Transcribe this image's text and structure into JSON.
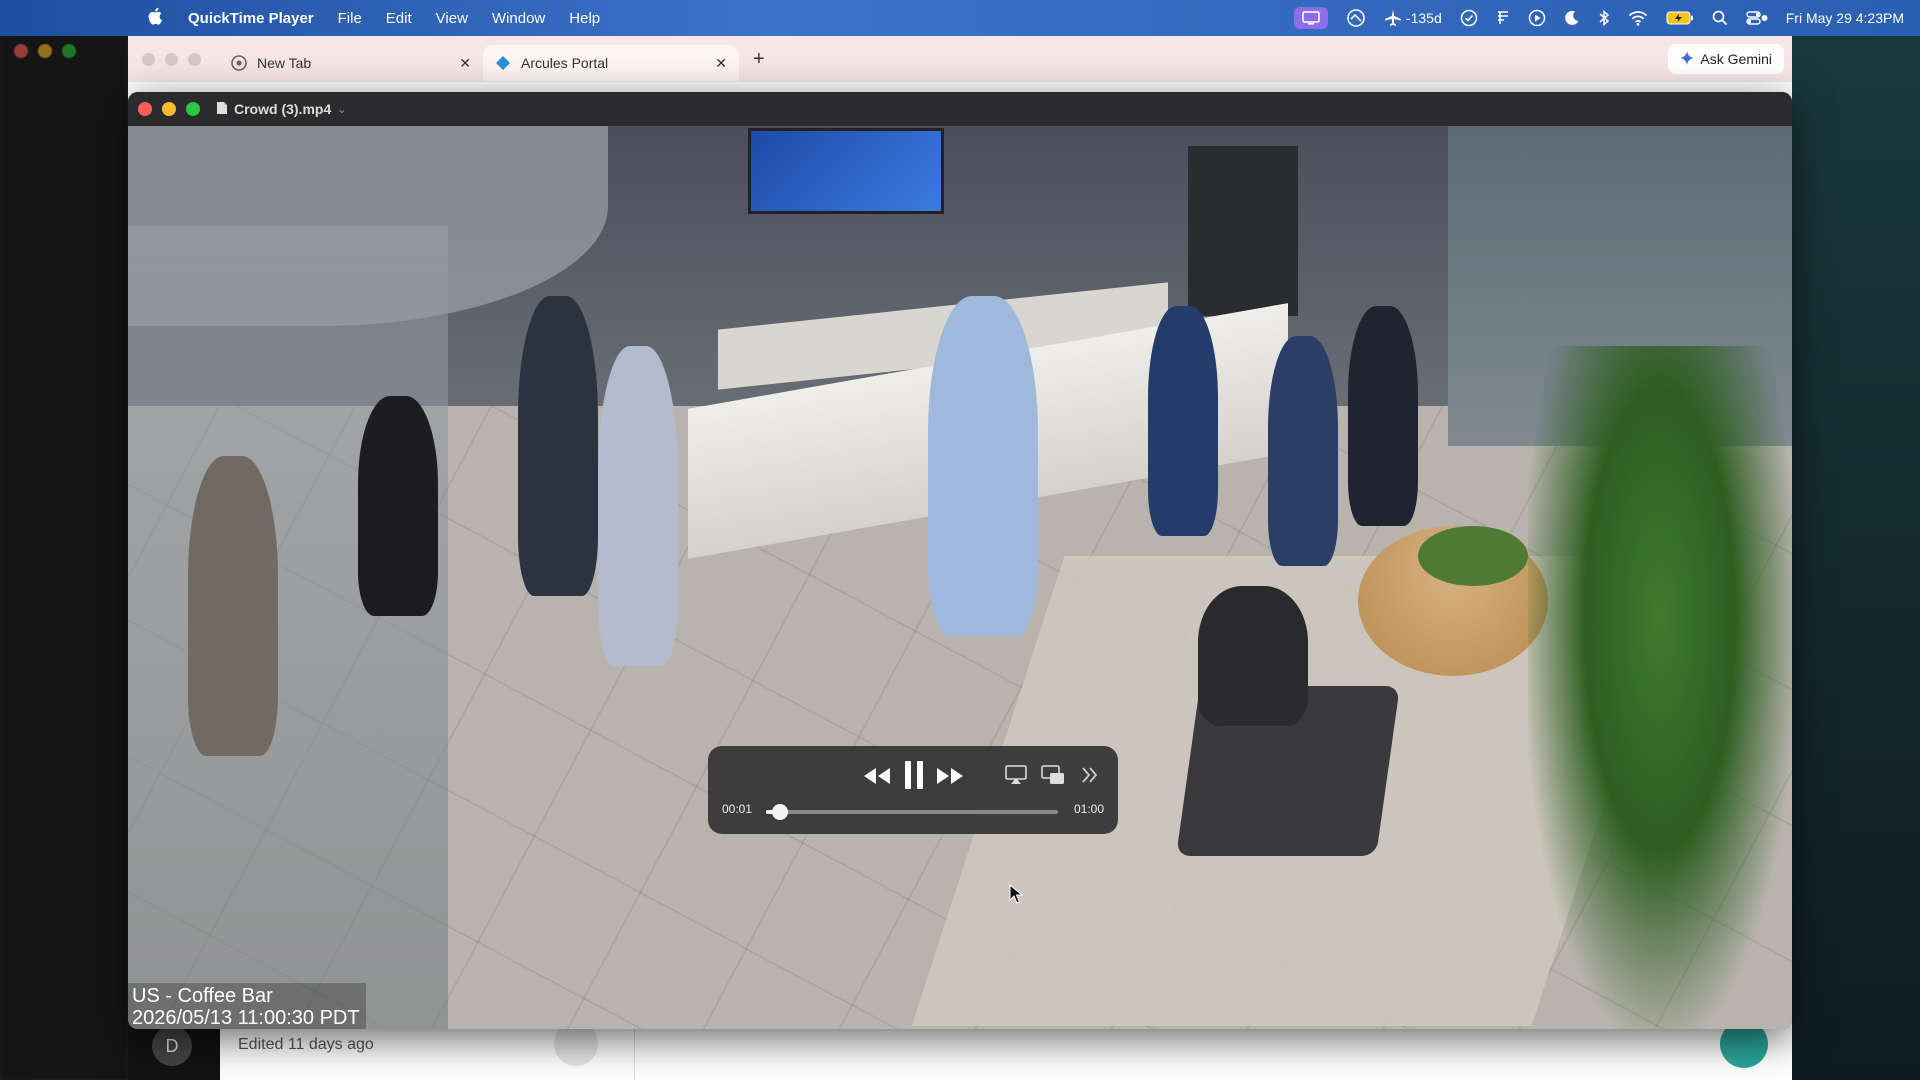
{
  "menubar": {
    "app_name": "QuickTime Player",
    "menus": [
      "File",
      "Edit",
      "View",
      "Window",
      "Help"
    ],
    "airplane_label": "-135d",
    "clock": "Fri May 29  4:23PM"
  },
  "browser": {
    "tabs": [
      {
        "label": "New Tab"
      },
      {
        "label": "Arcules Portal"
      }
    ],
    "ask_gemini_label": "Ask Gemini",
    "bottom": {
      "avatar_letter": "D",
      "edited_text": "Edited 11 days ago"
    }
  },
  "quicktime": {
    "file_name": "Crowd (3).mp4",
    "overlay": {
      "camera_name": "US - Coffee Bar",
      "timestamp": "2026/05/13 11:00:30 PDT"
    },
    "controls": {
      "current_time": "00:01",
      "duration": "01:00",
      "progress": 0.047
    }
  },
  "colors": {
    "menubar_accent": "#2a5fb2",
    "tab_strip": "#f7e6e6",
    "close_red": "#ff5f57",
    "minimize_yellow": "#febc2e",
    "maximize_green": "#28c840"
  }
}
